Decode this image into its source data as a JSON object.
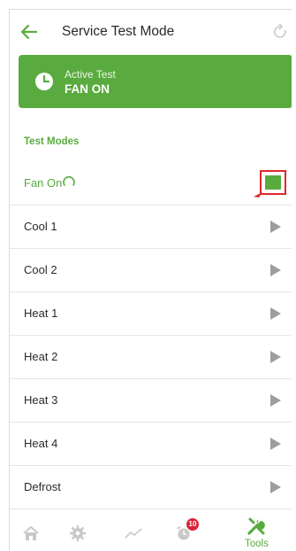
{
  "header": {
    "title": "Service Test Mode",
    "back_icon": "arrow-left-icon",
    "refresh_icon": "refresh-icon"
  },
  "banner": {
    "subtitle": "Active Test",
    "status": "FAN ON",
    "icon": "clock-icon",
    "color": "#5aab3f"
  },
  "section": {
    "title": "Test Modes"
  },
  "active_mode": {
    "label": "Fan On",
    "spinner_icon": "loading-spinner-icon",
    "stop_icon": "stop-square-icon"
  },
  "modes": [
    {
      "label": "Cool 1"
    },
    {
      "label": "Cool 2"
    },
    {
      "label": "Heat 1"
    },
    {
      "label": "Heat 2"
    },
    {
      "label": "Heat 3"
    },
    {
      "label": "Heat 4"
    },
    {
      "label": "Defrost"
    }
  ],
  "tabbar": {
    "items": [
      {
        "icon": "home-icon"
      },
      {
        "icon": "gear-icon"
      },
      {
        "icon": "trend-chart-icon"
      },
      {
        "icon": "alarm-icon",
        "badge": "10"
      },
      {
        "icon": "tools-icon",
        "label": "Tools",
        "active": true
      }
    ]
  },
  "colors": {
    "accent": "#5aab3f",
    "highlight": "#e0262b",
    "badge": "#d9253a"
  }
}
